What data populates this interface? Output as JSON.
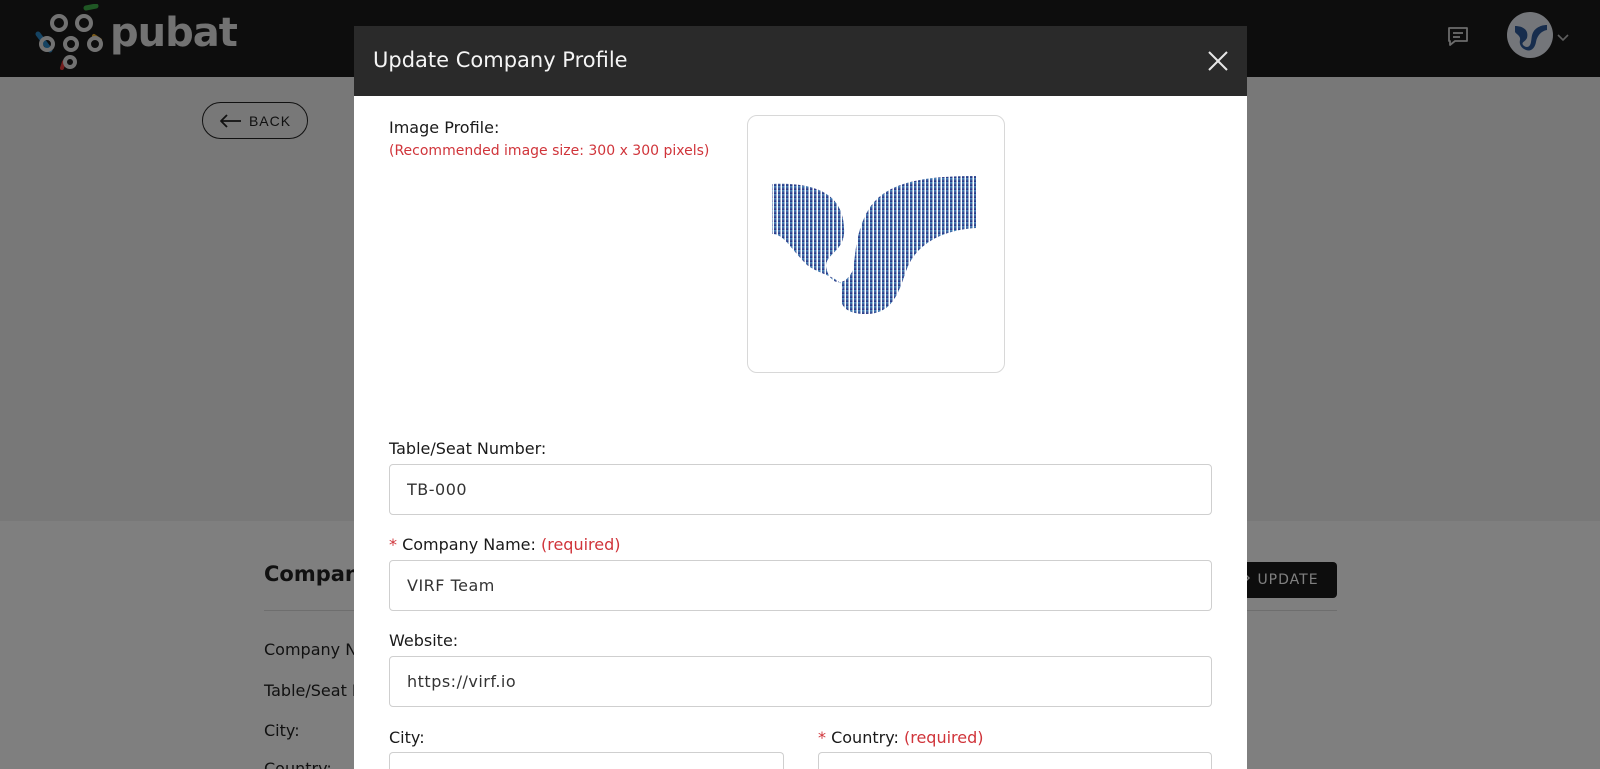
{
  "app": {
    "logo_text": "pubat",
    "brand_colors": {
      "red": "#e53a3a",
      "green": "#3fae49",
      "blue": "#2b86c5",
      "yellow": "#f2b233"
    }
  },
  "topbar": {
    "chat_icon": "chat-bubble-icon",
    "avatar_icon": "virf-logo-avatar"
  },
  "page": {
    "back_label": "BACK",
    "section_title": "Company",
    "labels": [
      "Company N",
      "Table/Seat N",
      "City:",
      "Country:"
    ],
    "update_label": "UPDATE"
  },
  "modal": {
    "title": "Update Company Profile",
    "image_profile": {
      "label": "Image Profile:",
      "hint": "(Recommended image size: 300 x 300 pixels)"
    },
    "table_seat": {
      "label": "Table/Seat Number:",
      "value": "TB-000"
    },
    "company_name": {
      "star": "*",
      "label": "Company Name:",
      "required": "(required)",
      "value": "VIRF Team"
    },
    "website": {
      "label": "Website:",
      "value": "https://virf.io"
    },
    "city": {
      "label": "City:",
      "value": ""
    },
    "country": {
      "star": "*",
      "label": "Country:",
      "required": "(required)",
      "value": ""
    }
  },
  "colors": {
    "topbar_bg": "#1b1b1b",
    "modal_header_bg": "#2a2a2a",
    "required_red": "#d0343a",
    "logo_gradient_top": "#4f8fbf",
    "logo_gradient_bottom": "#2a2f80"
  }
}
